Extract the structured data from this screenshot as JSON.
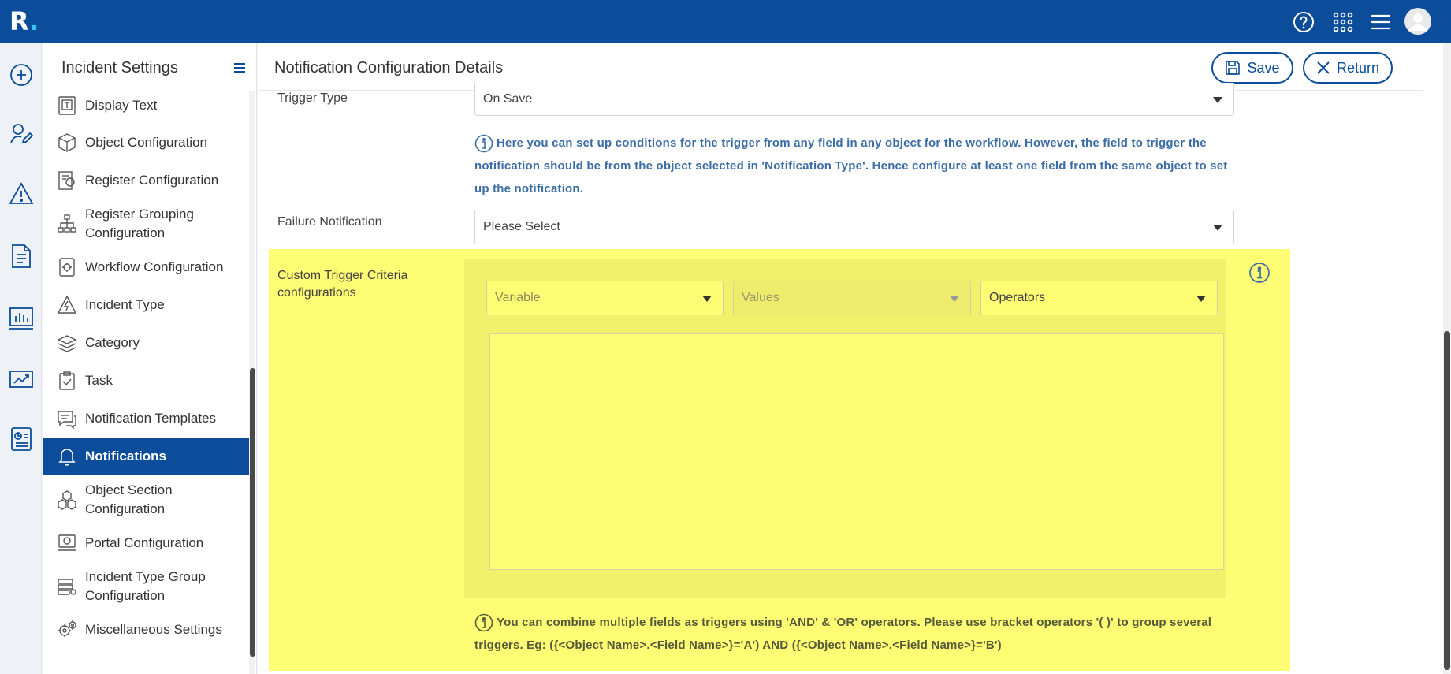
{
  "app": {
    "logo_letter": "R",
    "logo_dot": "."
  },
  "topbar": {
    "icons": [
      "help-icon",
      "apps-grid-icon",
      "hamburger-icon",
      "user-avatar"
    ]
  },
  "rail": {
    "icons": [
      "add-icon",
      "user-edit-icon",
      "warning-icon",
      "document-icon",
      "dashboard-icon",
      "analytics-icon",
      "report-icon"
    ]
  },
  "sidebar": {
    "title": "Incident Settings",
    "items": [
      {
        "label": "Display Text"
      },
      {
        "label": "Object Configuration"
      },
      {
        "label": "Register Configuration"
      },
      {
        "label": "Register Grouping Configuration"
      },
      {
        "label": "Workflow Configuration"
      },
      {
        "label": "Incident Type"
      },
      {
        "label": "Category"
      },
      {
        "label": "Task"
      },
      {
        "label": "Notification Templates"
      },
      {
        "label": "Notifications"
      },
      {
        "label": "Object Section Configuration"
      },
      {
        "label": "Portal Configuration"
      },
      {
        "label": "Incident Type Group Configuration"
      },
      {
        "label": "Miscellaneous Settings"
      }
    ],
    "active_item": "Notifications"
  },
  "header": {
    "title": "Notification Configuration Details",
    "save_label": "Save",
    "return_label": "Return"
  },
  "form": {
    "trigger_type": {
      "label": "Trigger Type",
      "value": "On Save"
    },
    "trigger_info": "Here you can set up conditions for the trigger from any field in any object for the workflow. However, the field to trigger the notification should be from the object selected in 'Notification Type'. Hence configure at least one field from the same object to set up the notification.",
    "failure_notification": {
      "label": "Failure Notification",
      "value": "Please Select"
    },
    "custom_trigger": {
      "label": "Custom Trigger Criteria configurations",
      "variable_placeholder": "Variable",
      "values_placeholder": "Values",
      "operators_placeholder": "Operators",
      "criteria_text": "",
      "help": "You can combine multiple fields as triggers using 'AND' & 'OR' operators. Please use bracket operators '( )' to group several triggers. Eg: ({<Object Name>.<Field Name>}='A') AND ({<Object Name>.<Field Name>}='B')"
    }
  },
  "colors": {
    "brand": "#0b4d9a",
    "highlight": "#fffd73",
    "info_text": "#3d6da6"
  }
}
